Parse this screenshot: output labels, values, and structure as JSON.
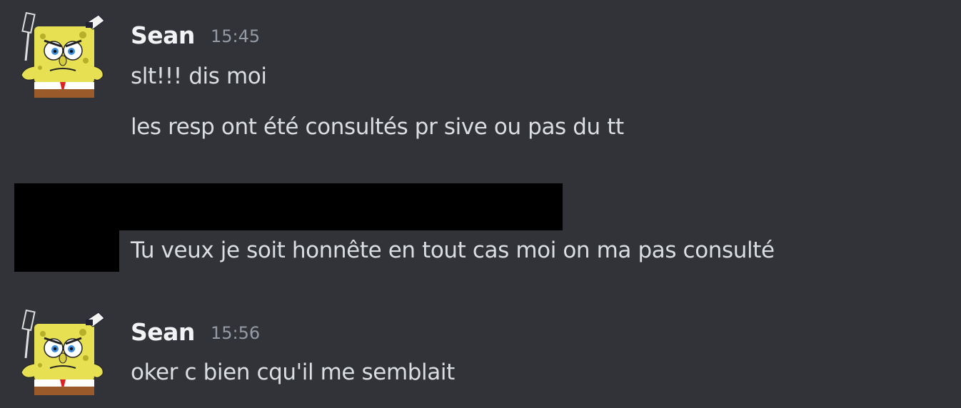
{
  "messages": [
    {
      "author": "Sean",
      "time": "15:45",
      "lines": [
        "slt!!! dis moi",
        "les resp ont été consultés pr sive ou pas du tt"
      ]
    },
    {
      "author": "",
      "time": "",
      "lines": [
        "Tu veux je soit honnête en tout cas moi on ma pas consulté"
      ]
    },
    {
      "author": "Sean",
      "time": "15:56",
      "lines": [
        "oker c bien cqu'il me semblait"
      ]
    }
  ],
  "avatar_icon": "spongebob-avatar-icon",
  "colors": {
    "background": "#313338",
    "username": "#f2f3f5",
    "text": "#dbdee1",
    "timestamp": "#949ba4"
  }
}
